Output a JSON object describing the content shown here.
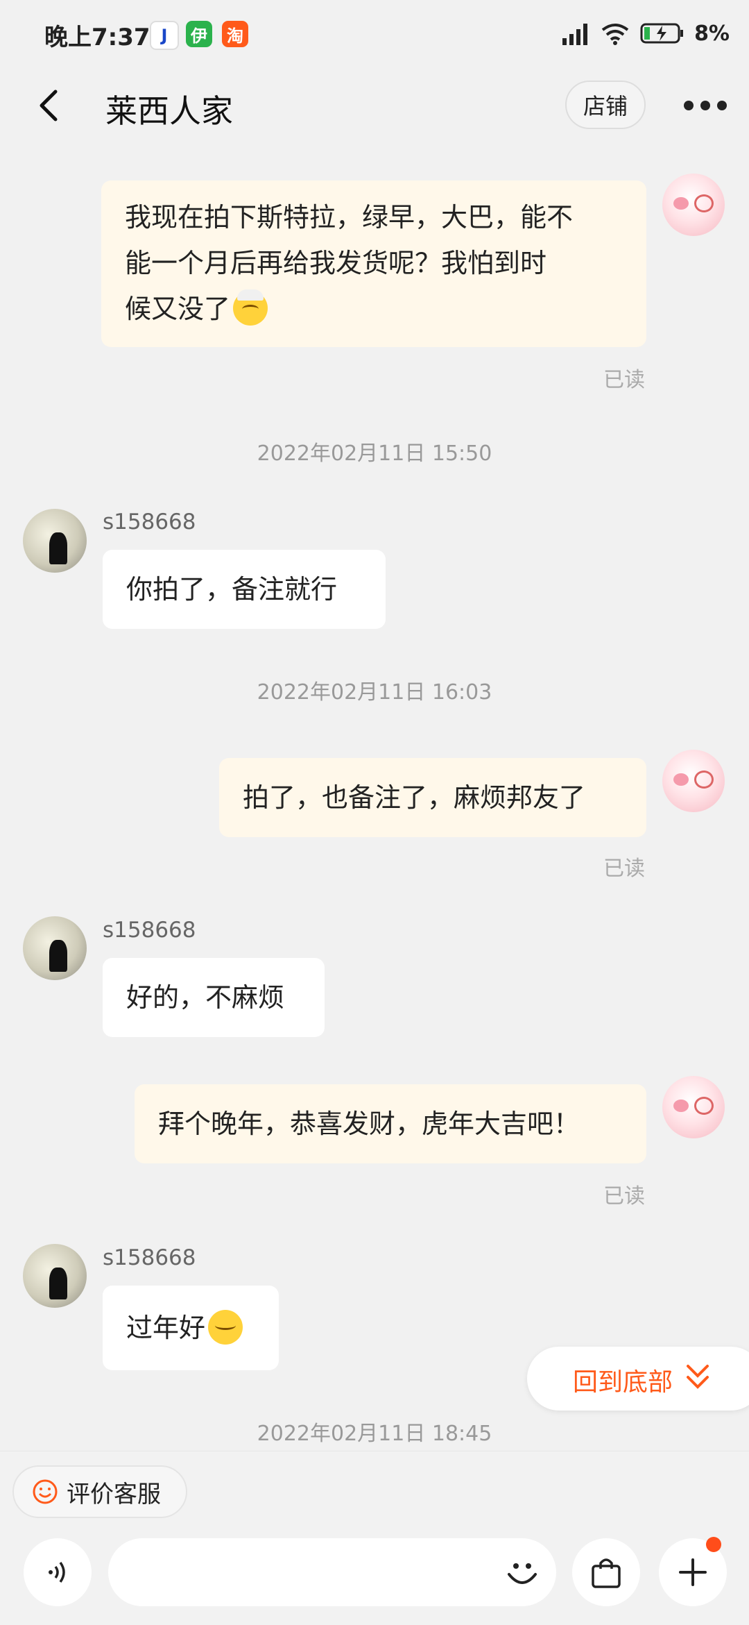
{
  "status_bar": {
    "time": "晚上7:37",
    "app_icons": [
      "J",
      "伊",
      "淘"
    ],
    "battery_percent": "8%"
  },
  "header": {
    "title": "莱西人家",
    "shop_label": "店铺"
  },
  "messages": [
    {
      "side": "me",
      "text": "我现在拍下斯特拉，绿早，大巴，能不能一个月后再给我发货呢？我怕到时候又没了",
      "lines": [
        "我现在拍下斯特拉，绿早，大巴，能不",
        "能一个月后再给我发货呢？我怕到时",
        "候又没了"
      ],
      "read": "已读"
    },
    {
      "type": "timestamp",
      "text": "2022年02月11日 15:50"
    },
    {
      "side": "them",
      "sender": "s158668",
      "text": "你拍了，备注就行"
    },
    {
      "type": "timestamp",
      "text": "2022年02月11日 16:03"
    },
    {
      "side": "me",
      "text": "拍了，也备注了，麻烦邦友了",
      "read": "已读"
    },
    {
      "side": "them",
      "sender": "s158668",
      "text": "好的，不麻烦"
    },
    {
      "side": "me",
      "text": "拜个晚年，恭喜发财，虎年大吉吧！",
      "read": "已读"
    },
    {
      "side": "them",
      "sender": "s158668",
      "text": "过年好"
    },
    {
      "type": "timestamp",
      "text": "2022年02月11日 18:45"
    }
  ],
  "back_to_bottom": "回到底部",
  "bottom_bar": {
    "rate_label": "评价客服"
  },
  "colors": {
    "accent": "#ff5a1a",
    "my_bubble": "#fff8ea",
    "their_bubble": "#ffffff",
    "background": "#f1f1f1"
  }
}
